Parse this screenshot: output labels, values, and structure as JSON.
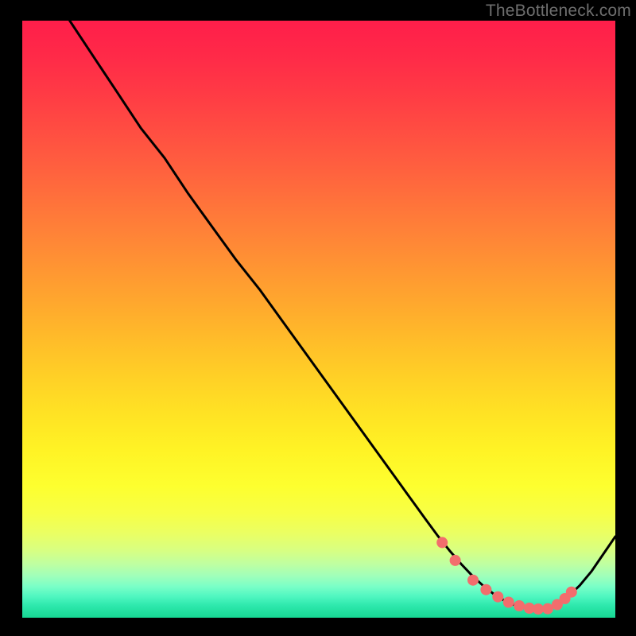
{
  "watermark": "TheBottleneck.com",
  "chart_data": {
    "type": "line",
    "title": "",
    "xlabel": "",
    "ylabel": "",
    "xlim": [
      0,
      100
    ],
    "ylim": [
      0,
      100
    ],
    "series": [
      {
        "name": "curve",
        "x": [
          8,
          12,
          16,
          20,
          24,
          28,
          32,
          36,
          40,
          44,
          48,
          52,
          56,
          60,
          64,
          68,
          70,
          72,
          74,
          76,
          78,
          80,
          82,
          84,
          86,
          88,
          90,
          92,
          94,
          96,
          100
        ],
        "y": [
          100,
          94,
          88,
          82,
          77,
          71,
          65.5,
          60,
          55,
          49.5,
          44,
          38.5,
          33,
          27.5,
          22,
          16.5,
          13.8,
          11.3,
          9.0,
          6.9,
          5.1,
          3.6,
          2.5,
          1.8,
          1.4,
          1.4,
          2.1,
          3.5,
          5.4,
          7.8,
          13.6
        ]
      }
    ],
    "markers": {
      "name": "dots",
      "x": [
        70.8,
        73.0,
        76.0,
        78.2,
        80.2,
        82.0,
        83.8,
        85.5,
        87.0,
        88.6,
        90.2,
        91.5,
        92.6
      ],
      "y": [
        12.6,
        9.6,
        6.3,
        4.7,
        3.5,
        2.6,
        2.0,
        1.6,
        1.45,
        1.5,
        2.2,
        3.2,
        4.3
      ]
    },
    "gradient_stops": [
      {
        "offset": 0.0,
        "color": "#ff1e4a"
      },
      {
        "offset": 0.06,
        "color": "#ff2a48"
      },
      {
        "offset": 0.12,
        "color": "#ff3a45"
      },
      {
        "offset": 0.18,
        "color": "#ff4c42"
      },
      {
        "offset": 0.24,
        "color": "#ff5e3f"
      },
      {
        "offset": 0.3,
        "color": "#ff713b"
      },
      {
        "offset": 0.36,
        "color": "#ff8437"
      },
      {
        "offset": 0.42,
        "color": "#ff9732"
      },
      {
        "offset": 0.48,
        "color": "#ffaa2d"
      },
      {
        "offset": 0.54,
        "color": "#ffbe29"
      },
      {
        "offset": 0.6,
        "color": "#ffd126"
      },
      {
        "offset": 0.66,
        "color": "#ffe324"
      },
      {
        "offset": 0.72,
        "color": "#fff325"
      },
      {
        "offset": 0.78,
        "color": "#fdff2f"
      },
      {
        "offset": 0.825,
        "color": "#f7ff46"
      },
      {
        "offset": 0.86,
        "color": "#eaff64"
      },
      {
        "offset": 0.888,
        "color": "#d7ff83"
      },
      {
        "offset": 0.91,
        "color": "#bfffa1"
      },
      {
        "offset": 0.93,
        "color": "#a0ffba"
      },
      {
        "offset": 0.948,
        "color": "#79ffc7"
      },
      {
        "offset": 0.964,
        "color": "#50f7c1"
      },
      {
        "offset": 0.98,
        "color": "#2de8ac"
      },
      {
        "offset": 1.0,
        "color": "#17d793"
      }
    ],
    "marker_color": "#f26d6d",
    "line_color": "#000000"
  }
}
